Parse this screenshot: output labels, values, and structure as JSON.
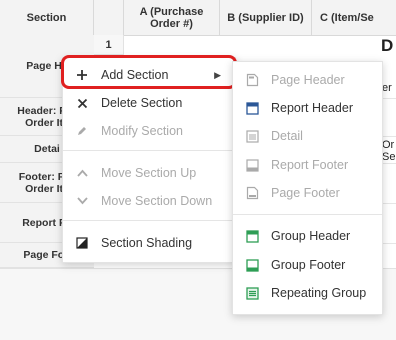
{
  "grid": {
    "headers": [
      {
        "label": "Section"
      },
      {
        "label": ""
      },
      {
        "label": "A (Purchase Order #)"
      },
      {
        "label": "B (Supplier ID)"
      },
      {
        "label": "C (Item/Se"
      }
    ],
    "row_number": "1",
    "sections": [
      {
        "label": "Page He"
      },
      {
        "label": "Header: Pur\nOrder Ite"
      },
      {
        "label": "Detai"
      },
      {
        "label": "Footer: Pur\nOrder Ite"
      },
      {
        "label": "Report Fo"
      },
      {
        "label": "Page Foo"
      }
    ],
    "peek_texts": [
      "D",
      "er",
      "Or",
      "Se"
    ]
  },
  "context_menu": {
    "items": [
      {
        "label": "Add Section",
        "icon": "plus-icon",
        "disabled": false,
        "has_submenu": true
      },
      {
        "label": "Delete Section",
        "icon": "close-icon",
        "disabled": false
      },
      {
        "label": "Modify Section",
        "icon": "pencil-icon",
        "disabled": true
      },
      {
        "label": "Move Section Up",
        "icon": "chevron-up-icon",
        "disabled": true
      },
      {
        "label": "Move Section Down",
        "icon": "chevron-down-icon",
        "disabled": true
      },
      {
        "label": "Section Shading",
        "icon": "shading-icon",
        "disabled": false
      }
    ]
  },
  "submenu": {
    "items": [
      {
        "label": "Page Header",
        "icon": "page-header-icon",
        "disabled": true
      },
      {
        "label": "Report Header",
        "icon": "report-header-icon",
        "disabled": false
      },
      {
        "label": "Detail",
        "icon": "detail-icon",
        "disabled": true
      },
      {
        "label": "Report Footer",
        "icon": "report-footer-icon",
        "disabled": true
      },
      {
        "label": "Page Footer",
        "icon": "page-footer-icon",
        "disabled": true
      },
      {
        "label": "Group Header",
        "icon": "group-header-icon",
        "disabled": false
      },
      {
        "label": "Group Footer",
        "icon": "group-footer-icon",
        "disabled": false
      },
      {
        "label": "Repeating Group",
        "icon": "repeating-group-icon",
        "disabled": false
      }
    ]
  },
  "colors": {
    "highlight": "#e02020",
    "icon_blue": "#2b5797",
    "icon_green": "#2e9e55",
    "disabled": "#aaaaaa"
  }
}
